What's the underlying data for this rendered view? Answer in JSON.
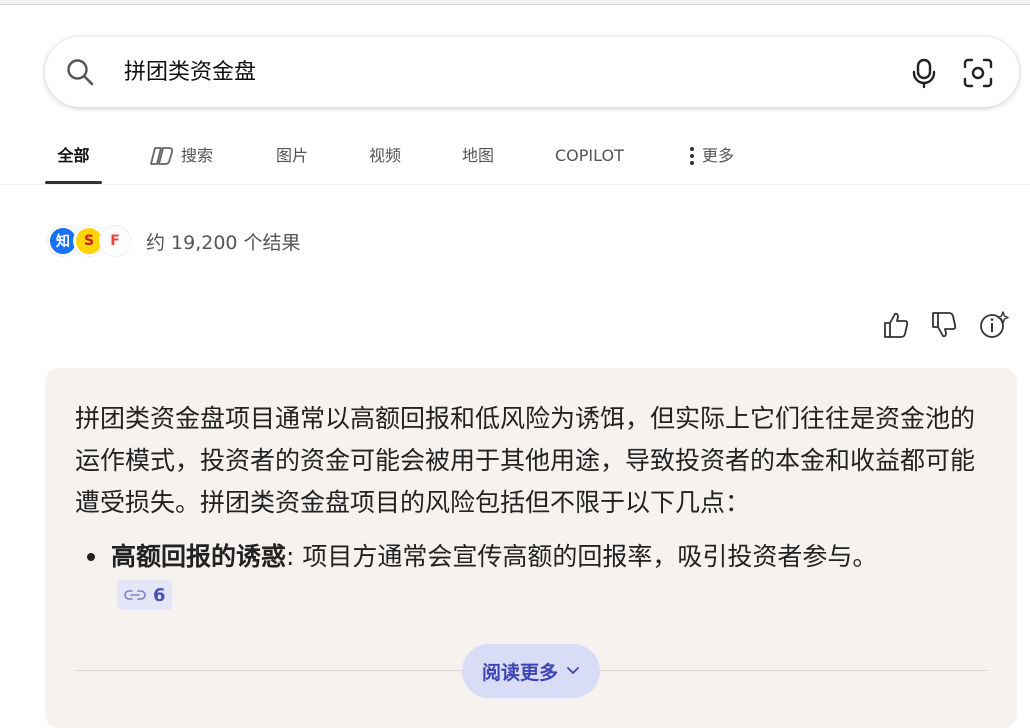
{
  "search": {
    "query": "拼团类资金盘"
  },
  "tabs": [
    {
      "label": "全部",
      "active": true
    },
    {
      "label": "搜索",
      "icon": "copilot-icon"
    },
    {
      "label": "图片"
    },
    {
      "label": "视频"
    },
    {
      "label": "地图"
    },
    {
      "label": "COPILOT"
    },
    {
      "label": "更多",
      "icon": "more-vertical-icon"
    }
  ],
  "results": {
    "sources": [
      {
        "label": "知",
        "name": "zhihu-icon"
      },
      {
        "label": "S",
        "name": "sohu-icon"
      },
      {
        "label": "F",
        "name": "source-f-icon"
      }
    ],
    "count_text": "约 19,200 个结果"
  },
  "answer": {
    "paragraph": "拼团类资金盘项目通常以高额回报和低风险为诱饵，但实际上它们往往是资金池的运作模式，投资者的资金可能会被用于其他用途，导致投资者的本金和收益都可能遭受损失。拼团类资金盘项目的风险包括但不限于以下几点：",
    "bullets": [
      {
        "title": "高额回报的诱惑",
        "text": ": 项目方通常会宣传高额的回报率，吸引投资者参与。",
        "citation_count": "6"
      }
    ],
    "read_more_label": "阅读更多"
  },
  "colors": {
    "card_bg": "#f6f2ef",
    "accent": "#3d46b0",
    "read_more_bg": "#d9dcf7"
  }
}
